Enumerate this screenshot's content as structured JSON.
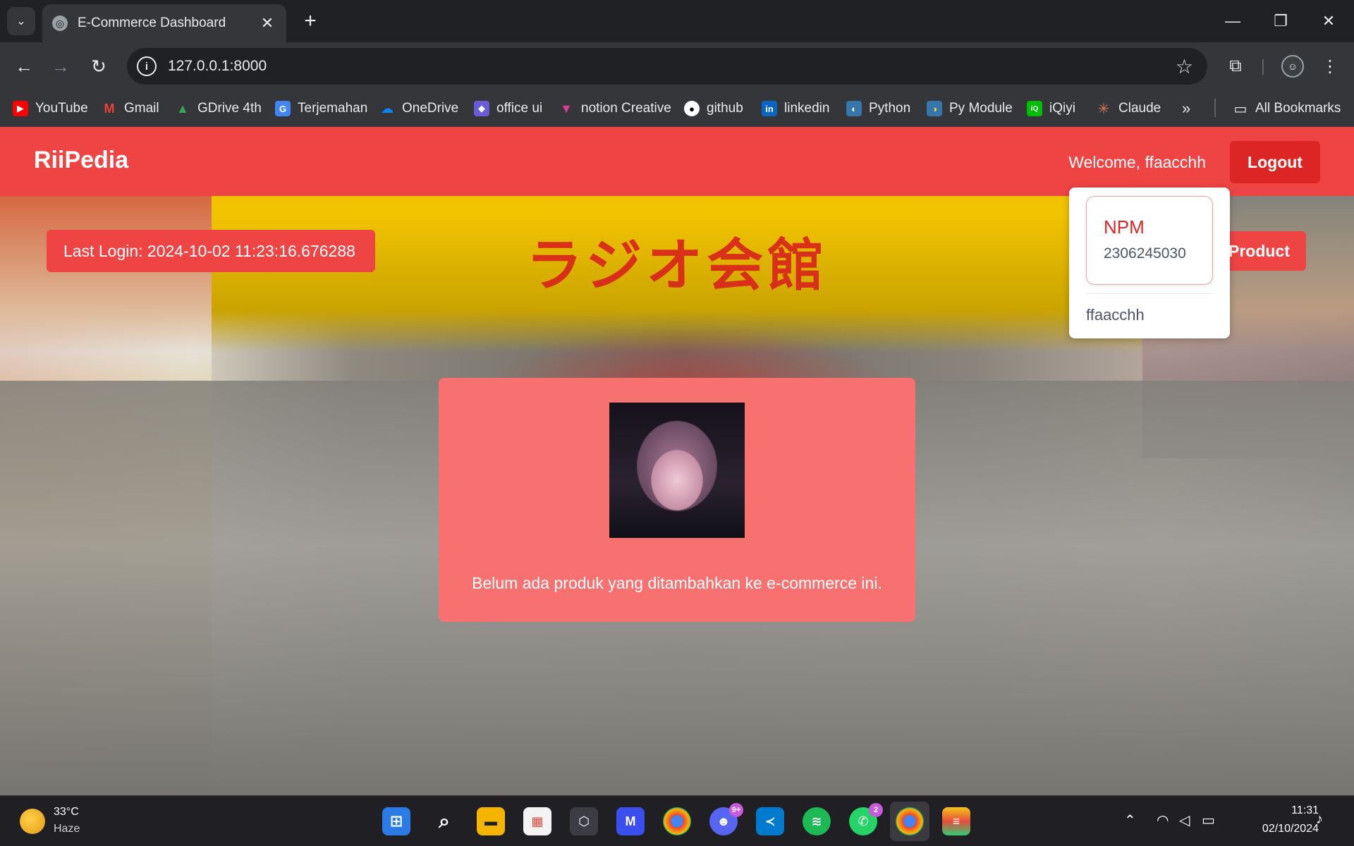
{
  "browser": {
    "tab_title": "E-Commerce Dashboard",
    "url": "127.0.0.1:8000",
    "bookmarks": [
      {
        "label": "YouTube",
        "icon": "youtube-icon",
        "color": "#ff0000"
      },
      {
        "label": "Gmail",
        "icon": "gmail-icon",
        "color": "#ea4335"
      },
      {
        "label": "GDrive 4th",
        "icon": "gdrive-icon",
        "color": "#34a853"
      },
      {
        "label": "Terjemahan",
        "icon": "translate-icon",
        "color": "#4285f4"
      },
      {
        "label": "OneDrive",
        "icon": "onedrive-icon",
        "color": "#0a84ff"
      },
      {
        "label": "office ui",
        "icon": "office-icon",
        "color": "#6b5bd6"
      },
      {
        "label": "notion Creative",
        "icon": "notion-creative-icon",
        "color": "#d63c8f"
      },
      {
        "label": "github",
        "icon": "github-icon",
        "color": "#ffffff"
      },
      {
        "label": "linkedin",
        "icon": "linkedin-icon",
        "color": "#0a66c2"
      },
      {
        "label": "Python",
        "icon": "python-icon",
        "color": "#3776ab"
      },
      {
        "label": "Py Module",
        "icon": "py-module-icon",
        "color": "#ffd343"
      },
      {
        "label": "iQiyi",
        "icon": "iqiyi-icon",
        "color": "#00be06"
      },
      {
        "label": "Claude",
        "icon": "claude-icon",
        "color": "#d97757"
      }
    ],
    "all_bookmarks_label": "All Bookmarks"
  },
  "navbar": {
    "brand": "RiiPedia",
    "welcome": "Welcome, ffaacchh",
    "logout_label": "Logout"
  },
  "main": {
    "last_login": "Last Login: 2024-10-02 11:23:16.676288",
    "add_product_label": "Product",
    "empty_message": "Belum ada produk yang ditambahkan ke e-commerce ini."
  },
  "profile_popup": {
    "npm_label": "NPM",
    "npm_value": "2306245030",
    "username": "ffaacchh"
  },
  "taskbar": {
    "weather_temp": "33°C",
    "weather_desc": "Haze",
    "discord_badge": "9+",
    "whatsapp_badge": "2",
    "time": "11:31",
    "date": "02/10/2024"
  },
  "colors": {
    "navbar": "#ef4444",
    "logout": "#dc2626",
    "empty_card": "#f87171"
  }
}
